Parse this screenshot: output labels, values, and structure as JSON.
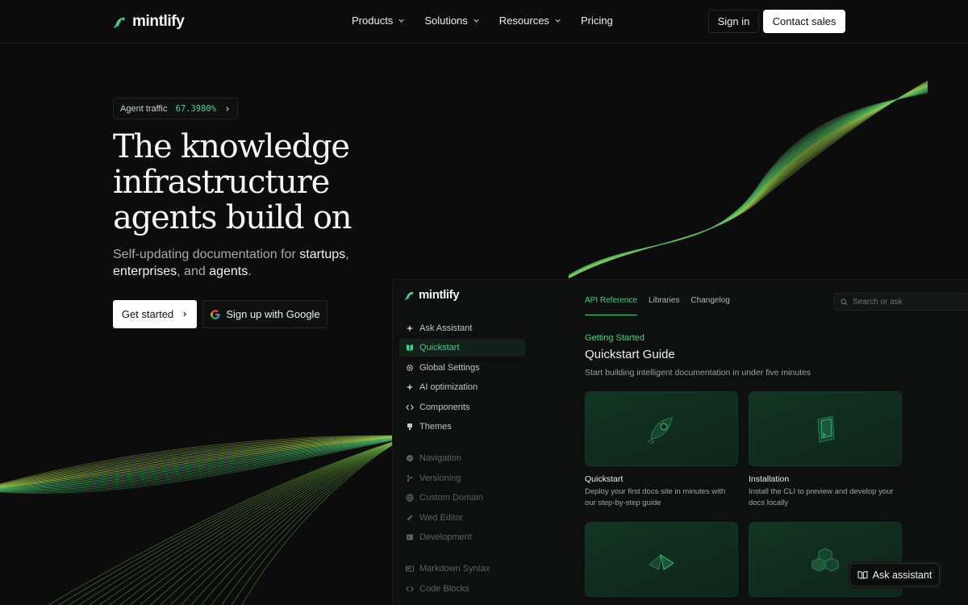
{
  "nav": {
    "brand": "mintlify",
    "menu": [
      {
        "label": "Products",
        "has_dropdown": true
      },
      {
        "label": "Solutions",
        "has_dropdown": true
      },
      {
        "label": "Resources",
        "has_dropdown": true
      },
      {
        "label": "Pricing",
        "has_dropdown": false
      }
    ],
    "sign_in": "Sign in",
    "contact_sales": "Contact sales"
  },
  "hero": {
    "pill_label": "Agent traffic",
    "pill_value": "67.3980%",
    "headline_1": "The knowledge",
    "headline_2": "infrastructure",
    "headline_3": "agents build on",
    "sub_1": "Self-updating documentation for ",
    "sub_startups": "startups",
    "sub_2": ",",
    "sub_enterprises": "enterprises",
    "sub_3": ", and ",
    "sub_agents": "agents",
    "sub_4": ".",
    "get_started": "Get started",
    "google_signup": "Sign up with Google"
  },
  "preview": {
    "brand": "mintlify",
    "sidebar": [
      {
        "label": "Ask Assistant",
        "icon": "sparkle-icon",
        "state": "normal"
      },
      {
        "label": "Quickstart",
        "icon": "book-icon",
        "state": "active"
      },
      {
        "label": "Global Settings",
        "icon": "gear-icon",
        "state": "normal"
      },
      {
        "label": "AI optimization",
        "icon": "sparkle-icon",
        "state": "normal"
      },
      {
        "label": "Components",
        "icon": "code-icon",
        "state": "normal"
      },
      {
        "label": "Themes",
        "icon": "palette-icon",
        "state": "normal"
      },
      {
        "label": "Navigation",
        "icon": "compass-icon",
        "state": "dim"
      },
      {
        "label": "Versioning",
        "icon": "branch-icon",
        "state": "dim"
      },
      {
        "label": "Custom Domain",
        "icon": "globe-icon",
        "state": "dim"
      },
      {
        "label": "Wed Editor",
        "icon": "pen-icon",
        "state": "dim"
      },
      {
        "label": "Development",
        "icon": "terminal-icon",
        "state": "dim"
      },
      {
        "label": "Markdown Syntax",
        "icon": "markdown-icon",
        "state": "dim"
      },
      {
        "label": "Code Blocks",
        "icon": "code-icon",
        "state": "dim"
      }
    ],
    "tabs": [
      "API Reference",
      "Libraries",
      "Changelog"
    ],
    "active_tab": "API Reference",
    "search_placeholder": "Search or ask",
    "kicker": "Getting Started",
    "title": "Quickstart Guide",
    "subtitle": "Start building intelligent documentation in under five minutes",
    "cards": [
      {
        "title": "Quickstart",
        "description": "Deploy your first docs site in minutes with our step-by-step guide",
        "icon": "rocket-icon"
      },
      {
        "title": "Installation",
        "description": "Install the CLI to preview and develop your docs locally",
        "icon": "terminal-window-icon"
      },
      {
        "title": "",
        "description": "",
        "icon": "shapes-icon"
      },
      {
        "title": "",
        "description": "",
        "icon": "cubes-icon"
      }
    ]
  },
  "ask_assistant": "Ask assistant",
  "colors": {
    "accent": "#3bd28a",
    "background": "#0b0c0b",
    "card": "#0f2a1b"
  }
}
